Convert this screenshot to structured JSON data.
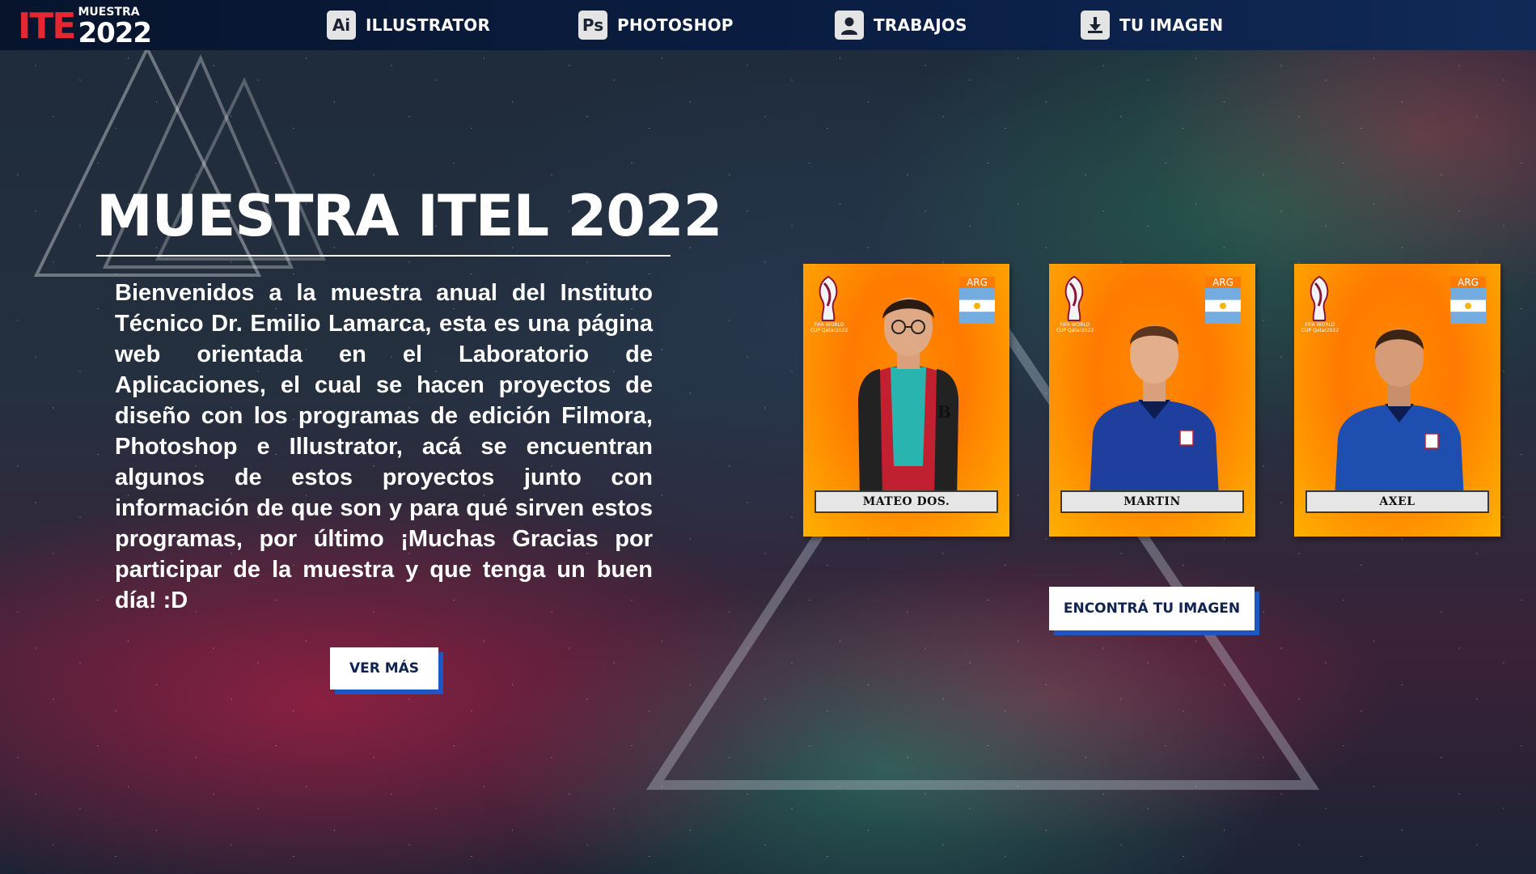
{
  "brand": {
    "logo_letters": "ITE",
    "logo_sub": "MUESTRA",
    "logo_year": "2022"
  },
  "nav": {
    "items": [
      {
        "label": "ILLUSTRATOR",
        "icon_text": "Ai",
        "icon": "illustrator-icon"
      },
      {
        "label": "PHOTOSHOP",
        "icon_text": "Ps",
        "icon": "photoshop-icon"
      },
      {
        "label": "TRABAJOS",
        "icon": "user-icon"
      },
      {
        "label": "TU IMAGEN",
        "icon": "download-icon"
      }
    ]
  },
  "hero": {
    "title": "MUESTRA ITEL 2022",
    "text": "Bienvenidos a la muestra anual del Instituto Técnico Dr. Emilio Lamarca, esta es una página web orientada en el Laboratorio de Aplicaciones, el cual se hacen proyectos de diseño con los programas de edición Filmora, Photoshop e Illustrator, acá se encuentran algunos de estos proyectos junto con información de que son y para qué sirven estos programas, por último ¡Muchas Gracias por participar de la muestra y que tenga un buen día! :D",
    "button_label": "VER MÁS"
  },
  "cards": [
    {
      "name": "MATEO DOS.",
      "country": "ARG",
      "cup_text": "FIFA WORLD CUP Qatar2022",
      "shirt": "#2ab4b0",
      "jacket": "#c0202f"
    },
    {
      "name": "MARTIN",
      "country": "ARG",
      "cup_text": "FIFA WORLD CUP Qatar2022",
      "shirt": "#1f3f9e",
      "jacket": "#1f3f9e"
    },
    {
      "name": "AXEL",
      "country": "ARG",
      "cup_text": "FIFA WORLD CUP Qatar2022",
      "shirt": "#1e4fb0",
      "jacket": "#1e4fb0"
    }
  ],
  "cta": {
    "label": "ENCONTRÁ TU IMAGEN"
  },
  "colors": {
    "nav_bg": "#0b1f45",
    "button_shadow": "#1d57c4",
    "card_orange": "#ff7a00",
    "accent_red": "#e8262f"
  }
}
